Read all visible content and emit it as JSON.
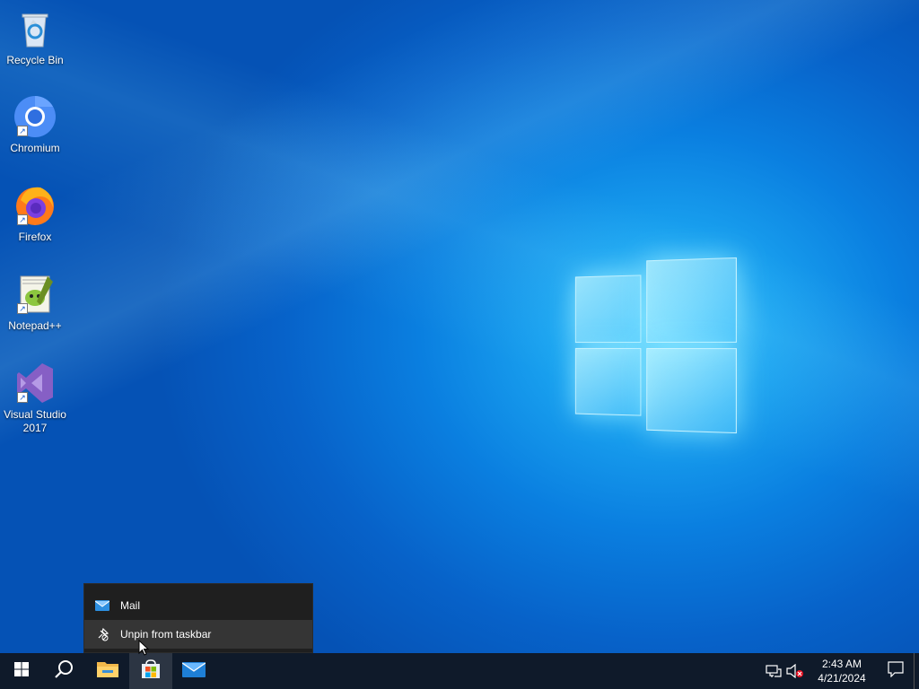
{
  "desktop": {
    "icons": [
      {
        "label": "Recycle Bin",
        "icon": "recycle-bin-icon"
      },
      {
        "label": "Chromium",
        "icon": "chromium-icon"
      },
      {
        "label": "Firefox",
        "icon": "firefox-icon"
      },
      {
        "label": "Notepad++",
        "icon": "notepad-plus-plus-icon"
      },
      {
        "label": "Visual Studio 2017",
        "icon": "visual-studio-icon"
      }
    ]
  },
  "context_menu": {
    "items": [
      {
        "label": "Mail",
        "icon": "mail-icon"
      },
      {
        "label": "Unpin from taskbar",
        "icon": "unpin-icon"
      }
    ]
  },
  "taskbar": {
    "buttons": [
      {
        "name": "start",
        "icon": "windows-start-icon"
      },
      {
        "name": "search",
        "icon": "search-icon"
      },
      {
        "name": "file-explorer",
        "icon": "folder-icon"
      },
      {
        "name": "microsoft-store",
        "icon": "store-icon"
      },
      {
        "name": "mail",
        "icon": "mail-icon"
      }
    ],
    "tray": {
      "network_icon": "network-icon",
      "volume_icon": "volume-muted-icon",
      "time": "2:43 AM",
      "date": "4/21/2024",
      "notification_icon": "action-center-icon"
    }
  },
  "colors": {
    "taskbar_bg": "#0f1a2a",
    "menu_bg": "#1f1f1f",
    "menu_hover": "#353535",
    "accent": "#76b9ed"
  }
}
